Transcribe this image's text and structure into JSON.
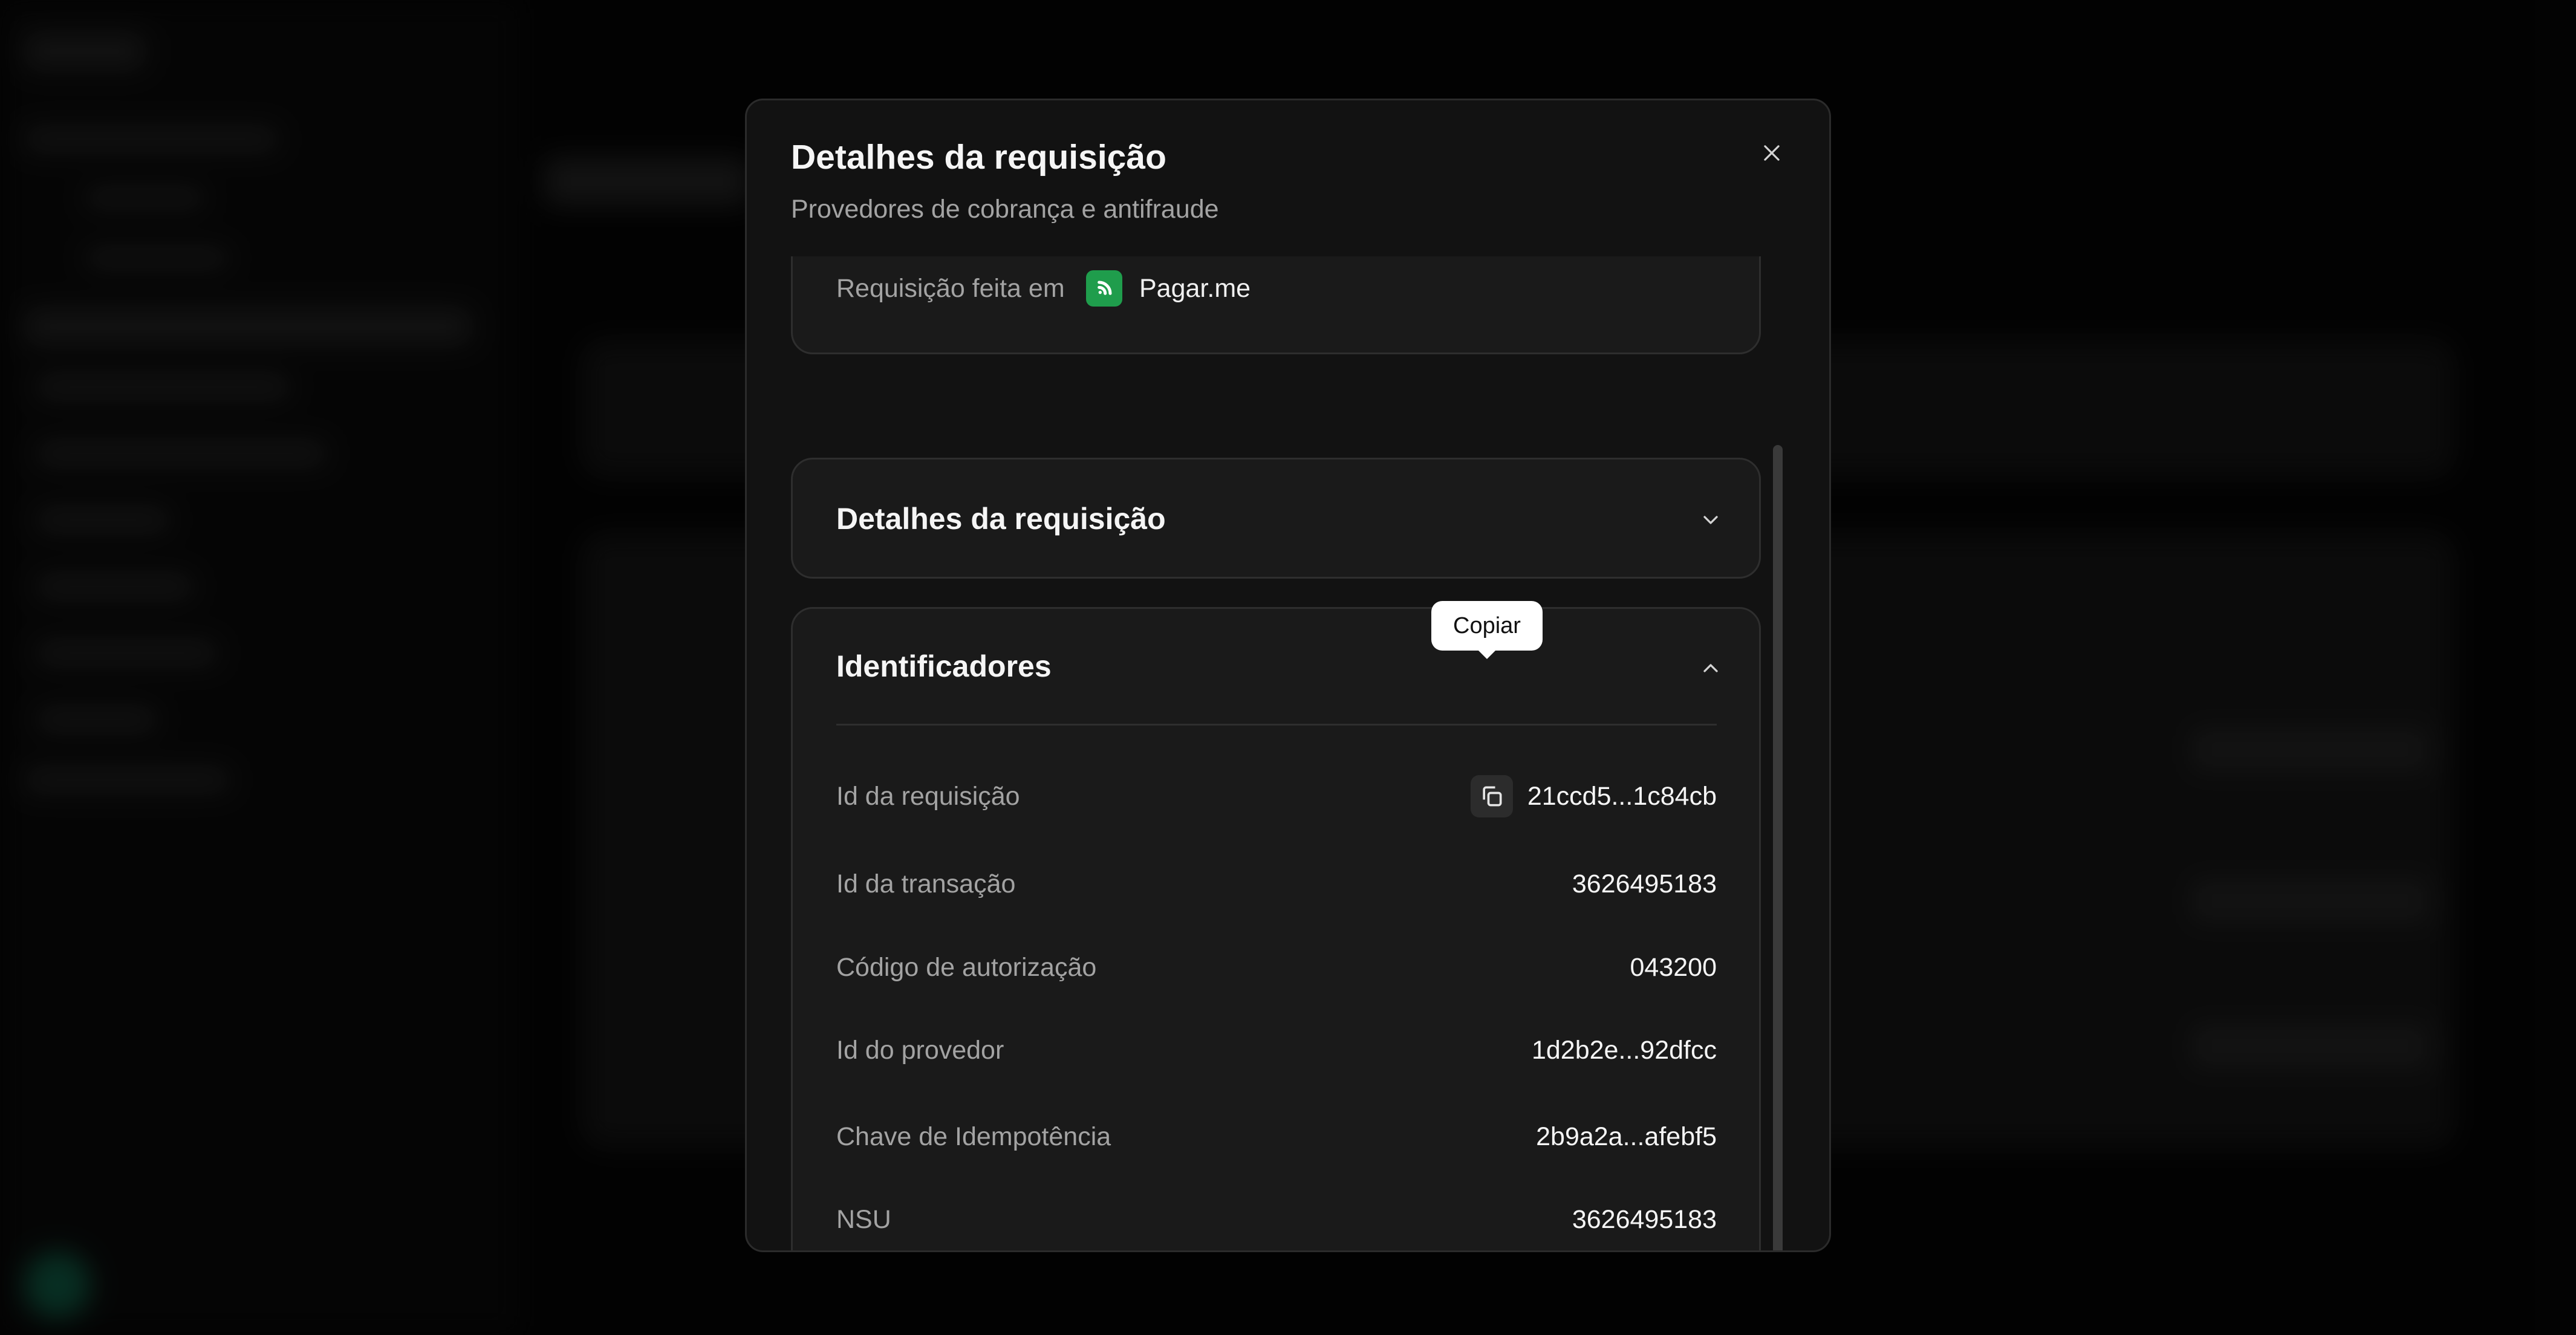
{
  "modal": {
    "title": "Detalhes da requisição",
    "subtitle": "Provedores de cobrança e antifraude",
    "close_icon": "close-icon"
  },
  "previous_section": {
    "label": "Requisição feita em",
    "provider_name": "Pagar.me",
    "provider_color": "#1f9d4c"
  },
  "request_details": {
    "title": "Detalhes da requisição",
    "expanded": false
  },
  "identifiers": {
    "title": "Identificadores",
    "expanded": true,
    "tooltip": "Copiar",
    "rows": [
      {
        "label": "Id da requisição",
        "value": "21ccd5...1c84cb"
      },
      {
        "label": "Id da transação",
        "value": "3626495183"
      },
      {
        "label": "Código de autorização",
        "value": "043200"
      },
      {
        "label": "Id do provedor",
        "value": "1d2b2e...92dfcc"
      },
      {
        "label": "Chave de Idempotência",
        "value": "2b9a2a...afebf5"
      },
      {
        "label": "NSU",
        "value": "3626495183"
      }
    ]
  },
  "colors": {
    "modal_bg": "#121212",
    "card_bg": "#1a1a1a",
    "muted_text": "#a3a3a3"
  }
}
